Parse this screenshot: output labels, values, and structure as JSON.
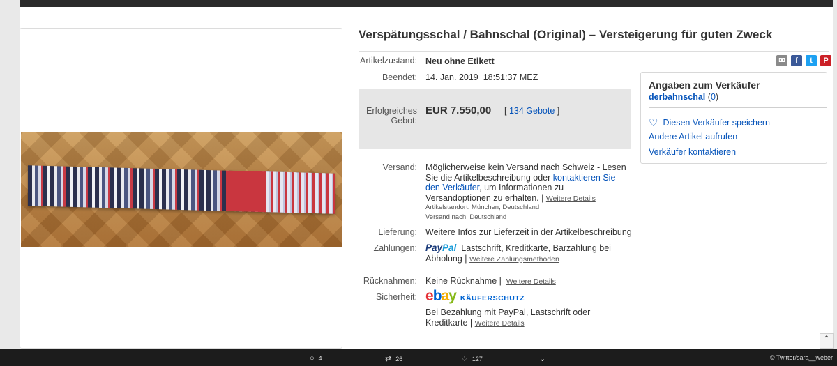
{
  "title": "Verspätungsschal / Bahnschal (Original) – Versteigerung für guten Zweck",
  "condition": {
    "label": "Artikelzustand:",
    "value": "Neu ohne Etikett"
  },
  "ended": {
    "label": "Beendet:",
    "date": "14. Jan. 2019",
    "time": "18:51:37 MEZ"
  },
  "bid": {
    "label_line1": "Erfolgreiches",
    "label_line2": "Gebot:",
    "amount": "EUR 7.550,00",
    "bracket_open": "[",
    "bids_link": "134 Gebote",
    "bracket_close": "]"
  },
  "shipping": {
    "label": "Versand:",
    "text1": "Möglicherweise kein Versand nach Schweiz - Lesen Sie die Artikelbeschreibung oder ",
    "contact_link": "kontaktieren Sie den Verkäufer",
    "text2": ", um Informationen zu Versandoptionen zu erhalten. | ",
    "more_link": "Weitere Details",
    "location": "Artikelstandort:  München, Deutschland",
    "ships_to": "Versand nach:  Deutschland"
  },
  "delivery": {
    "label": "Lieferung:",
    "value": "Weitere Infos zur Lieferzeit in der Artikelbeschreibung"
  },
  "payments": {
    "label": "Zahlungen:",
    "paypal_a": "Pay",
    "paypal_b": "Pal",
    "methods_line1": "Lastschrift,  Kreditkarte,  Barzahlung bei",
    "methods_line2": "Abholung  |",
    "more_link": "Weitere Zahlungsmethoden"
  },
  "returns": {
    "label": "Rücknahmen:",
    "value": "Keine Rücknahme |",
    "more_link": "Weitere Details"
  },
  "security": {
    "label": "Sicherheit:",
    "ebay": {
      "e": "e",
      "b": "b",
      "a": "a",
      "y": "y"
    },
    "protection": "KÄUFERSCHUTZ",
    "text_line1": "Bei Bezahlung mit PayPal, Lastschrift oder",
    "text_line2": "Kreditkarte |",
    "more_link": "Weitere Details"
  },
  "seller": {
    "heading": "Angaben zum Verkäufer",
    "name": "derbahnschal",
    "rating_open": "(",
    "rating": "0",
    "rating_close": ")",
    "save": "Diesen Verkäufer speichern",
    "other_items": "Andere Artikel aufrufen",
    "contact": "Verkäufer kontaktieren"
  },
  "share_icons": [
    "mail-icon",
    "facebook-icon",
    "twitter-icon",
    "pinterest-icon"
  ],
  "twitter_bar": {
    "replies": "4",
    "retweets": "26",
    "likes": "127",
    "credit": "© Twitter/sara__weber"
  },
  "colors": {
    "link": "#0654ba",
    "ebay_red": "#e53238",
    "ebay_blue": "#0064d2",
    "ebay_yellow": "#f5af02",
    "ebay_green": "#86b817",
    "paypal_dark": "#1b3b7a",
    "paypal_light": "#199bd8"
  }
}
